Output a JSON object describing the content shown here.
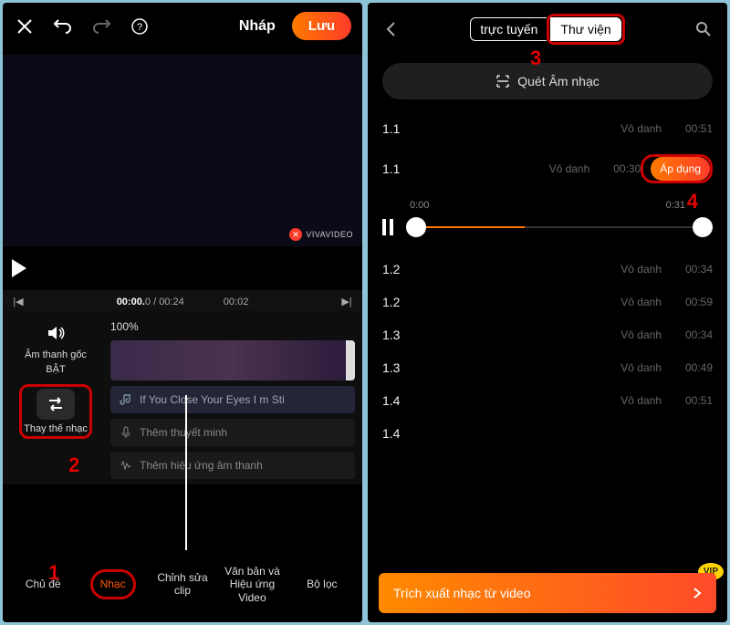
{
  "left": {
    "topbar": {
      "import_label": "Nháp",
      "save_label": "Lưu"
    },
    "watermark": "VIVAVIDEO",
    "timeline": {
      "cur": "00:00.",
      "cur_frac": "0",
      "total": "00:24",
      "marker": "00:02"
    },
    "audio_col": {
      "original_audio": "Âm thanh gốc",
      "original_state": "BẬT",
      "replace": "Thay thế nhạc",
      "zoom": "100%"
    },
    "tracks": {
      "music": "If You Close Your Eyes I m Sti",
      "voice": "Thêm thuyết minh",
      "sfx": "Thêm hiệu ứng âm thanh"
    },
    "tabs": {
      "theme": "Chủ đề",
      "music": "Nhạc",
      "clip": "Chỉnh sửa clip",
      "text": "Văn bản và Hiệu ứng Video",
      "filter": "Bộ lọc"
    },
    "annotations": {
      "n1": "1",
      "n2": "2"
    }
  },
  "right": {
    "seg": {
      "online": "trực tuyến",
      "library": "Thư viện"
    },
    "scan": "Quét Âm nhạc",
    "songs": [
      {
        "name": "1.1",
        "artist": "Vô danh",
        "dur": "00:51"
      },
      {
        "name": "1.1",
        "artist": "Vô danh",
        "dur": "00:30",
        "apply": "Áp dụng"
      },
      {
        "name": "1.2",
        "artist": "Vô danh",
        "dur": "00:34"
      },
      {
        "name": "1.2",
        "artist": "Vô danh",
        "dur": "00:59"
      },
      {
        "name": "1.3",
        "artist": "Vô danh",
        "dur": "00:34"
      },
      {
        "name": "1.3",
        "artist": "Vô danh",
        "dur": "00:49"
      },
      {
        "name": "1.4",
        "artist": "Vô danh",
        "dur": "00:51"
      },
      {
        "name": "1.4",
        "artist": "",
        "dur": ""
      }
    ],
    "player": {
      "start": "0:00",
      "end": "0:31"
    },
    "extract": "Trích xuất nhạc từ video",
    "vip": "VIP",
    "annotations": {
      "n3": "3",
      "n4": "4"
    }
  }
}
